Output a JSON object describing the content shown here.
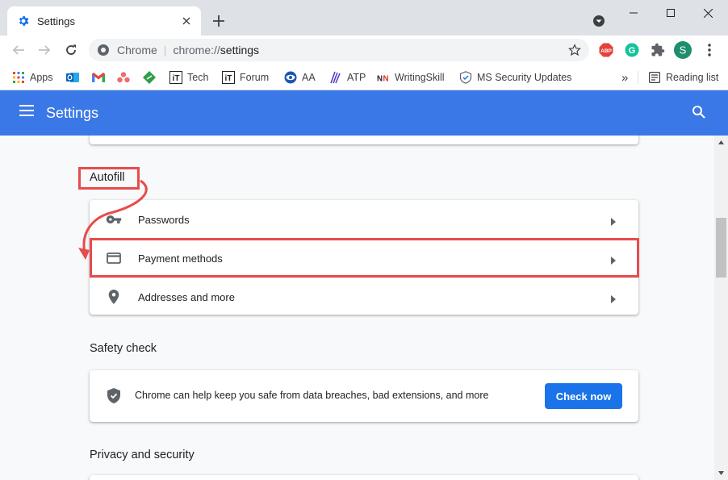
{
  "tab": {
    "title": "Settings"
  },
  "window_controls": {
    "tab_search_icon": "chevron-down-circle-icon"
  },
  "omnibox": {
    "chip": "Chrome",
    "separator": "|",
    "scheme": "chrome://",
    "path": "settings"
  },
  "extensions": [
    {
      "name": "abp-icon",
      "label": "ABP",
      "color": "#e5423a"
    },
    {
      "name": "grammarly-icon",
      "label": "G",
      "color": "#15c39a"
    },
    {
      "name": "puzzle-icon",
      "label": "",
      "color": "#5f6368"
    },
    {
      "name": "profile-avatar",
      "label": "S",
      "color": "#1e8e6f"
    }
  ],
  "bookmarks": {
    "items": [
      {
        "label": "Apps"
      },
      {
        "label": ""
      },
      {
        "label": ""
      },
      {
        "label": ""
      },
      {
        "label": ""
      },
      {
        "label": "Tech"
      },
      {
        "label": "Forum"
      },
      {
        "label": "AA"
      },
      {
        "label": "ATP"
      },
      {
        "label": "WritingSkill"
      },
      {
        "label": "MS Security Updates"
      }
    ],
    "overflow": "»",
    "reading_list": "Reading list"
  },
  "header": {
    "title": "Settings"
  },
  "autofill": {
    "title": "Autofill",
    "rows": [
      {
        "label": "Passwords",
        "icon": "key-icon"
      },
      {
        "label": "Payment methods",
        "icon": "credit-card-icon"
      },
      {
        "label": "Addresses and more",
        "icon": "location-pin-icon"
      }
    ]
  },
  "safety_check": {
    "title": "Safety check",
    "description": "Chrome can help keep you safe from data breaches, bad extensions, and more",
    "button": "Check now"
  },
  "privacy": {
    "title": "Privacy and security"
  },
  "colors": {
    "header_blue": "#3b78e7",
    "primary_button": "#1a73e8",
    "annotation_red": "#e74c4c"
  }
}
